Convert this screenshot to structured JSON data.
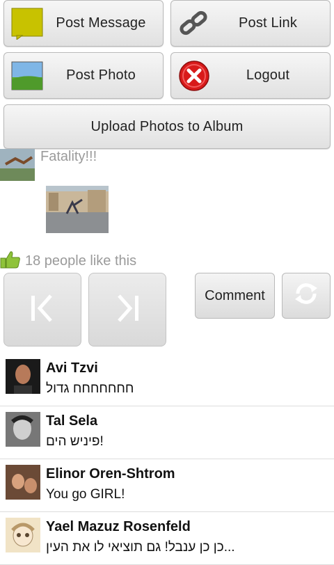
{
  "toolbar": {
    "post_message": "Post Message",
    "post_link": "Post Link",
    "post_photo": "Post Photo",
    "logout": "Logout",
    "upload_album": "Upload Photos to Album"
  },
  "post": {
    "status_text": "Fatality!!!"
  },
  "likes": {
    "text": "18 people like this"
  },
  "actions": {
    "comment": "Comment"
  },
  "comments": [
    {
      "name": "Avi Tzvi",
      "text": "חחחחחחח גדול"
    },
    {
      "name": "Tal Sela",
      "text": "פיניש הים!"
    },
    {
      "name": "Elinor Oren-Shtrom",
      "text": "You go GIRL!"
    },
    {
      "name": "Yael Mazuz Rosenfeld",
      "text": "כן כן ענבל! גם תוציאי לו את העין..."
    }
  ],
  "colors": {
    "message_icon": "#c8c200",
    "logout_icon": "#d81a1a",
    "like_icon": "#8fc33a",
    "muted_text": "#9a9a9a"
  }
}
